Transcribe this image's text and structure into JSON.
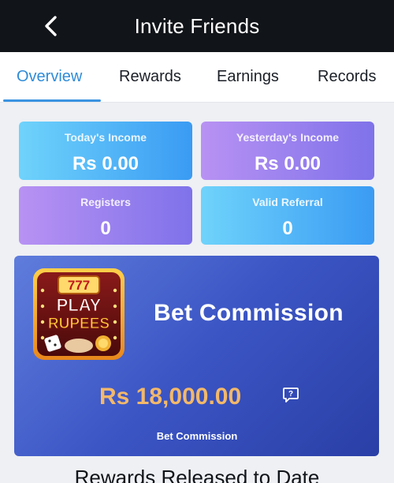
{
  "header": {
    "title": "Invite Friends"
  },
  "tabs": [
    {
      "label": "Overview",
      "active": true
    },
    {
      "label": "Rewards",
      "active": false
    },
    {
      "label": "Earnings",
      "active": false
    },
    {
      "label": "Records",
      "active": false
    }
  ],
  "stats": {
    "today_income": {
      "label": "Today's Income",
      "value": "Rs 0.00"
    },
    "yesterday_income": {
      "label": "Yesterday's Income",
      "value": "Rs 0.00"
    },
    "registers": {
      "label": "Registers",
      "value": "0"
    },
    "valid_referral": {
      "label": "Valid Referral",
      "value": "0"
    }
  },
  "commission": {
    "title": "Bet Commission",
    "amount": "Rs 18,000.00",
    "caption": "Bet Commission",
    "logo_text": [
      "PLAY",
      "RUPEES"
    ],
    "logo_reels": "777"
  },
  "section": {
    "heading": "Rewards Released to Date"
  },
  "colors": {
    "accent": "#2f8cd8",
    "amount": "#f3b86a",
    "topbar": "#111418"
  }
}
